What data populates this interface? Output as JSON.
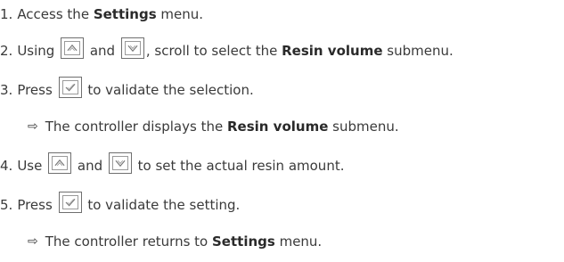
{
  "steps": [
    {
      "number": "1.",
      "parts": [
        {
          "t": "Access the "
        },
        {
          "b": "Settings"
        },
        {
          "t": " menu."
        }
      ]
    },
    {
      "number": "2.",
      "parts": [
        {
          "t": "Using "
        },
        {
          "icon": "up-key-icon"
        },
        {
          "t": " and "
        },
        {
          "icon": "down-key-icon"
        },
        {
          "t": ", scroll to select the "
        },
        {
          "b": "Resin volume"
        },
        {
          "t": " submenu."
        }
      ]
    },
    {
      "number": "3.",
      "parts": [
        {
          "t": "Press "
        },
        {
          "icon": "ok-key-icon"
        },
        {
          "t": " to validate the selection."
        }
      ],
      "result": {
        "arrow": "⇨",
        "parts": [
          {
            "t": "The controller displays the "
          },
          {
            "b": "Resin volume"
          },
          {
            "t": " submenu."
          }
        ]
      }
    },
    {
      "number": "4.",
      "parts": [
        {
          "t": "Use "
        },
        {
          "icon": "up-key-icon"
        },
        {
          "t": " and "
        },
        {
          "icon": "down-key-icon"
        },
        {
          "t": " to set the actual resin amount."
        }
      ]
    },
    {
      "number": "5.",
      "parts": [
        {
          "t": "Press "
        },
        {
          "icon": "ok-key-icon"
        },
        {
          "t": " to validate the setting."
        }
      ],
      "result": {
        "arrow": "⇨",
        "parts": [
          {
            "t": "The controller returns to "
          },
          {
            "b": "Settings"
          },
          {
            "t": " menu."
          }
        ]
      }
    }
  ]
}
